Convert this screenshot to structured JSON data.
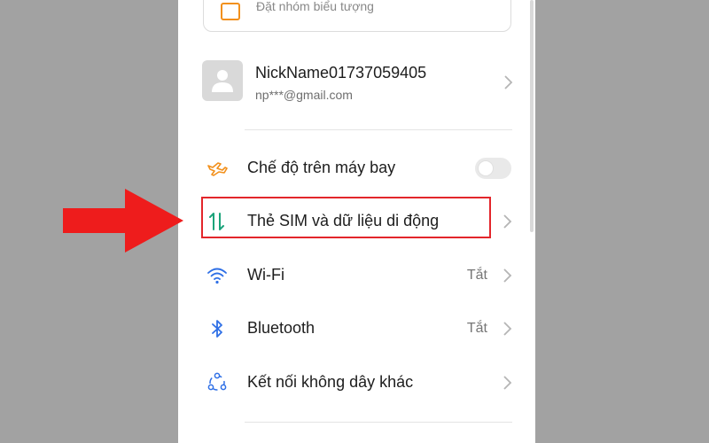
{
  "top_card": {
    "text": "Đặt nhóm biểu tượng",
    "icon": "image-icon",
    "icon_color": "#f2901c"
  },
  "profile": {
    "name": "NickName01737059405",
    "email": "np***@gmail.com",
    "avatar_icon": "person-icon"
  },
  "settings": [
    {
      "label": "Chế độ trên máy bay",
      "icon": "airplane-icon",
      "icon_color": "#f2901c",
      "control": "toggle",
      "toggle_on": false
    },
    {
      "label": "Thẻ SIM và dữ liệu di động",
      "icon": "sim-data-icon",
      "icon_color": "#1aa37a",
      "control": "chevron",
      "highlighted": true
    },
    {
      "label": "Wi-Fi",
      "icon": "wifi-icon",
      "icon_color": "#2e6fe6",
      "value": "Tắt",
      "control": "chevron"
    },
    {
      "label": "Bluetooth",
      "icon": "bluetooth-icon",
      "icon_color": "#2e6fe6",
      "value": "Tắt",
      "control": "chevron"
    },
    {
      "label": "Kết nối không dây khác",
      "icon": "connections-icon",
      "icon_color": "#2e6fe6",
      "control": "chevron"
    }
  ],
  "annotation": {
    "arrow_color": "#ee1c1c",
    "box_color": "#e3262b"
  }
}
